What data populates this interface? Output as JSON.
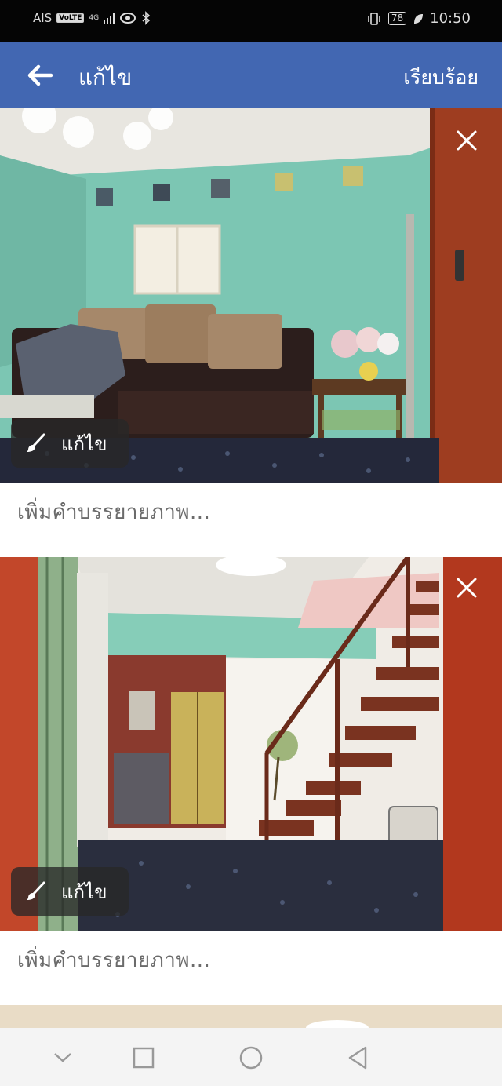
{
  "status_bar": {
    "carrier": "AIS",
    "volte": "VoLTE",
    "network": "4G",
    "battery": "78",
    "time": "10:50"
  },
  "app_bar": {
    "title": "แก้ไข",
    "done_label": "เรียบร้อย"
  },
  "photos": [
    {
      "edit_label": "แก้ไข",
      "caption_placeholder": "เพิ่มคำบรรยายภาพ..."
    },
    {
      "edit_label": "แก้ไข",
      "caption_placeholder": "เพิ่มคำบรรยายภาพ..."
    }
  ],
  "colors": {
    "app_bar": "#4267b2",
    "status_bar": "#050505",
    "nav_bar": "#f4f4f4"
  },
  "icons": {
    "back": "arrow-left-icon",
    "close": "close-icon",
    "edit": "brush-icon",
    "nav_back": "triangle-back-icon",
    "nav_home": "circle-home-icon",
    "nav_recents": "square-recents-icon",
    "nav_hide": "chevron-down-icon"
  }
}
